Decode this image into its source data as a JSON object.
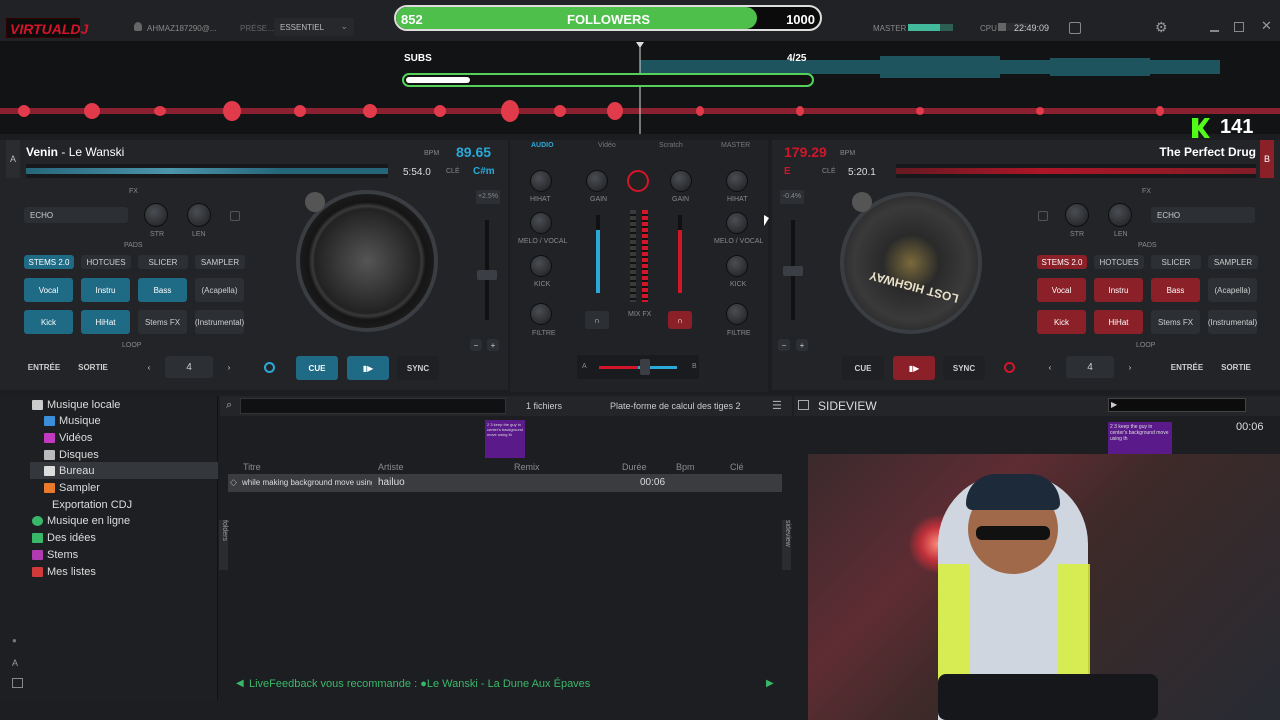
{
  "topbar": {
    "logo": "VIRTUALDJ",
    "user": "AHMAZ187290@...",
    "preset_label": "PRÉSE...",
    "preset_value": "ESSENTIEL",
    "master": "MASTER",
    "cpu": "CPU",
    "clock": "22:49:09"
  },
  "overlay": {
    "followers_current": "852",
    "followers_label": "FOLLOWERS",
    "followers_goal": "1000",
    "followers_fraction": 0.852,
    "subs_label": "SUBS",
    "subs_count": "4/25",
    "subs_fraction": 0.16,
    "k_count": "141"
  },
  "left_deck": {
    "letter": "A",
    "artist": "Venin",
    "title": "Le Wanski",
    "bpm_label": "BPM",
    "bpm": "89.65",
    "time": "5:54.0",
    "key_label": "CLÉ",
    "key": "C#m",
    "pitch": "+2.5%",
    "fx_label": "FX",
    "fx": "ECHO",
    "str": "STR",
    "len": "LEN",
    "pads_label": "PADS",
    "pad_tabs": [
      "STEMS 2.0",
      "HOTCUES",
      "SLICER",
      "SAMPLER"
    ],
    "pads": [
      "Vocal",
      "Instru",
      "Bass",
      "(Acapella)",
      "Kick",
      "HiHat",
      "Stems FX",
      "(Instrumental)"
    ],
    "loop_label": "LOOP",
    "entree": "ENTRÉE",
    "sortie": "SORTIE",
    "loop_value": "4",
    "cue": "CUE",
    "sync": "SYNC"
  },
  "right_deck": {
    "letter": "B",
    "title": "The Perfect Drug",
    "bpm_label": "BPM",
    "bpm": "179.29",
    "time": "5:20.1",
    "key_label": "CLÉ",
    "key": "E",
    "pitch": "-0.4%",
    "fx_label": "FX",
    "fx": "ECHO",
    "str": "STR",
    "len": "LEN",
    "pads_label": "PADS",
    "pad_tabs": [
      "STEMS 2.0",
      "HOTCUES",
      "SLICER",
      "SAMPLER"
    ],
    "pads": [
      "Vocal",
      "Instru",
      "Bass",
      "(Acapella)",
      "Kick",
      "HiHat",
      "Stems FX",
      "(Instrumental)"
    ],
    "loop_label": "LOOP",
    "entree": "ENTRÉE",
    "sortie": "SORTIE",
    "loop_value": "4",
    "cue": "CUE",
    "sync": "SYNC",
    "platter_text": "LOST HIGHWAY"
  },
  "mixer": {
    "tabs": [
      "AUDIO",
      "Vidéo",
      "Scratch",
      "MASTER"
    ],
    "labels": {
      "hihat": "HIHAT",
      "gain": "GAIN",
      "melo": "MELO / VOCAL",
      "kick": "KICK",
      "filtre": "FILTRE",
      "mixfx": "MIX FX"
    },
    "cross_a": "A",
    "cross_b": "B"
  },
  "browser": {
    "tree": [
      "Musique locale",
      "Musique",
      "Vidéos",
      "Disques",
      "Bureau",
      "Sampler",
      "Exportation CDJ",
      "Musique en ligne",
      "Des idées",
      "Stems",
      "Mes listes"
    ],
    "file_count": "1 fichiers",
    "folder_title": "Plate-forme de calcul des tiges 2",
    "columns": [
      "Titre",
      "Artiste",
      "Remix",
      "Durée",
      "Bpm",
      "Clé"
    ],
    "row": {
      "title": "while making background move using th",
      "artist": "hailuo",
      "duration": "00:06"
    },
    "thumb_text": "2 3 keep the guy in center's background move using th",
    "feedback": "LiveFeedback vous recommande : ●Le Wanski - La Dune Aux Épaves",
    "folders_tab": "folders",
    "sideview_tab": "sideview"
  },
  "sideview": {
    "title": "SIDEVIEW",
    "time": "00:06",
    "thumb_text": "2 3 keep the guy in center's background move using th"
  },
  "colors": {
    "blue": "#2aa8d8",
    "red": "#d3152a",
    "green": "#4fbf4c"
  }
}
